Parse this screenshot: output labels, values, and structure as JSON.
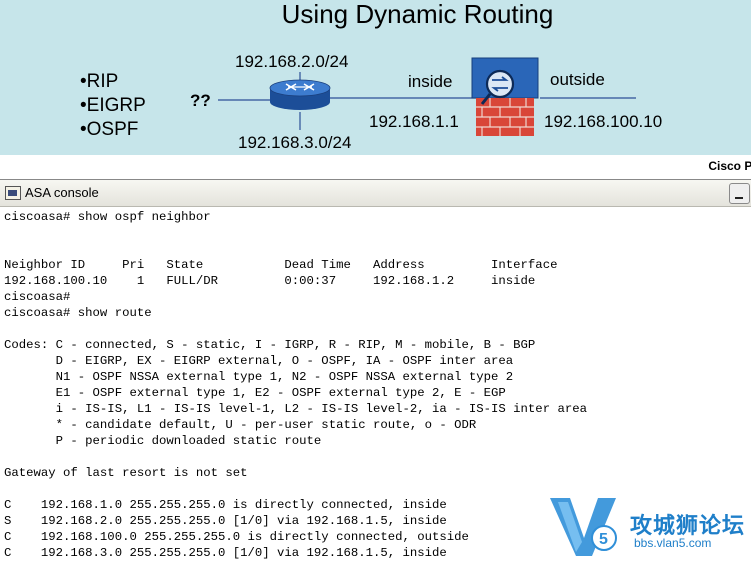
{
  "slide": {
    "title": "Using Dynamic Routing",
    "protocols": [
      "RIP",
      "EIGRP",
      "OSPF"
    ],
    "unknown_marker": "??",
    "router_top_network": "192.168.2.0/24",
    "router_bottom_network": "192.168.3.0/24",
    "inside_label": "inside",
    "inside_ip": "192.168.1.1",
    "outside_label": "outside",
    "outside_ip": "192.168.100.10",
    "brand": "Cisco Pr"
  },
  "window": {
    "title": "ASA console",
    "icon": "console-app-icon",
    "minimize_icon": "minimize-icon"
  },
  "console": {
    "lines": [
      "ciscoasa# show ospf neighbor",
      "",
      "",
      "Neighbor ID     Pri   State           Dead Time   Address         Interface",
      "192.168.100.10    1   FULL/DR         0:00:37     192.168.1.2     inside",
      "ciscoasa#",
      "ciscoasa# show route",
      "",
      "Codes: C - connected, S - static, I - IGRP, R - RIP, M - mobile, B - BGP",
      "       D - EIGRP, EX - EIGRP external, O - OSPF, IA - OSPF inter area",
      "       N1 - OSPF NSSA external type 1, N2 - OSPF NSSA external type 2",
      "       E1 - OSPF external type 1, E2 - OSPF external type 2, E - EGP",
      "       i - IS-IS, L1 - IS-IS level-1, L2 - IS-IS level-2, ia - IS-IS inter area",
      "       * - candidate default, U - per-user static route, o - ODR",
      "       P - periodic downloaded static route",
      "",
      "Gateway of last resort is not set",
      "",
      "C    192.168.1.0 255.255.255.0 is directly connected, inside",
      "S    192.168.2.0 255.255.255.0 [1/0] via 192.168.1.5, inside",
      "C    192.168.100.0 255.255.255.0 is directly connected, outside",
      "C    192.168.3.0 255.255.255.0 [1/0] via 192.168.1.5, inside"
    ]
  },
  "watermark": {
    "name": "攻城狮论坛",
    "url": "bbs.vlan5.com",
    "logo_text": "V5"
  },
  "colors": {
    "slide_background": "#c6e5ea",
    "router_blue": "#2a66b8",
    "firewall_brick": "#d94638",
    "watermark_blue": "#1f7fc9"
  }
}
